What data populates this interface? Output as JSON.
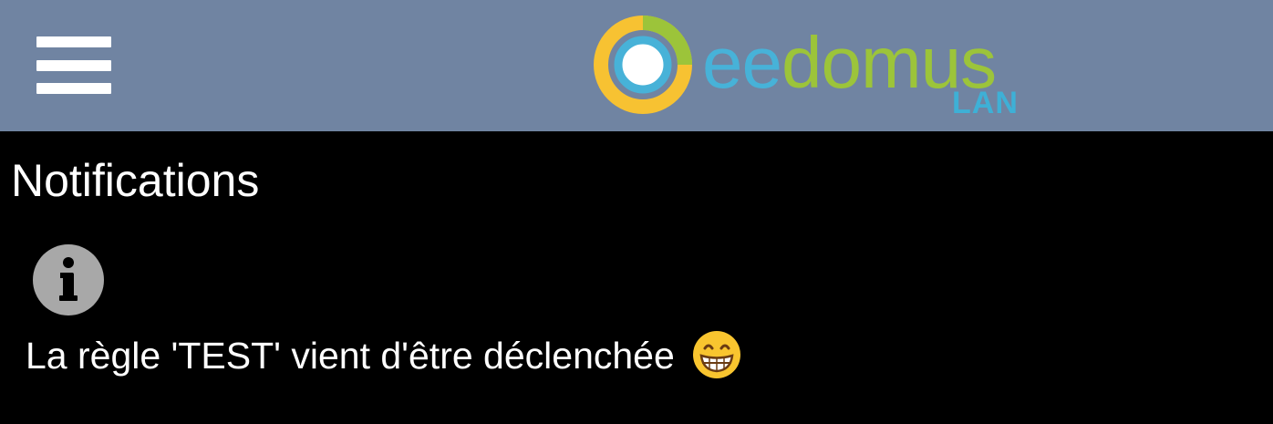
{
  "header": {
    "menu_icon": "hamburger-menu-icon",
    "logo": {
      "text_part1": "ee",
      "text_part2": "domus",
      "subtitle": "LAN"
    },
    "background_color": "#7084a2"
  },
  "page": {
    "title": "Notifications",
    "background_color": "#000000"
  },
  "notifications": [
    {
      "icon": "info-icon",
      "message": "La règle 'TEST' vient d'être déclenchée",
      "emoji": "grinning-face-emoji"
    }
  ]
}
